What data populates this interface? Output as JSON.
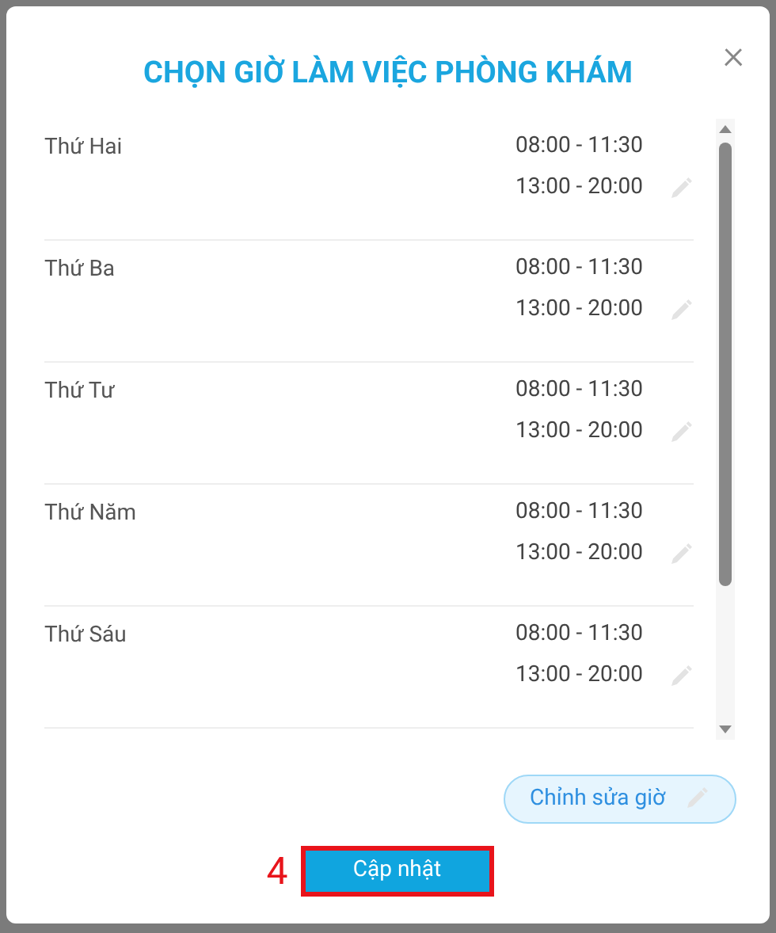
{
  "dialog": {
    "title": "CHỌN GIỜ LÀM VIỆC PHÒNG KHÁM",
    "close": "×"
  },
  "days": [
    {
      "name": "Thứ Hai",
      "slots": [
        "08:00 - 11:30",
        "13:00 - 20:00"
      ]
    },
    {
      "name": "Thứ Ba",
      "slots": [
        "08:00 - 11:30",
        "13:00 - 20:00"
      ]
    },
    {
      "name": "Thứ Tư",
      "slots": [
        "08:00 - 11:30",
        "13:00 - 20:00"
      ]
    },
    {
      "name": "Thứ Năm",
      "slots": [
        "08:00 - 11:30",
        "13:00 - 20:00"
      ]
    },
    {
      "name": "Thứ Sáu",
      "slots": [
        "08:00 - 11:30",
        "13:00 - 20:00"
      ]
    }
  ],
  "edit_button": "Chỉnh sửa giờ",
  "annotation": "4",
  "update_button": "Cập nhật"
}
